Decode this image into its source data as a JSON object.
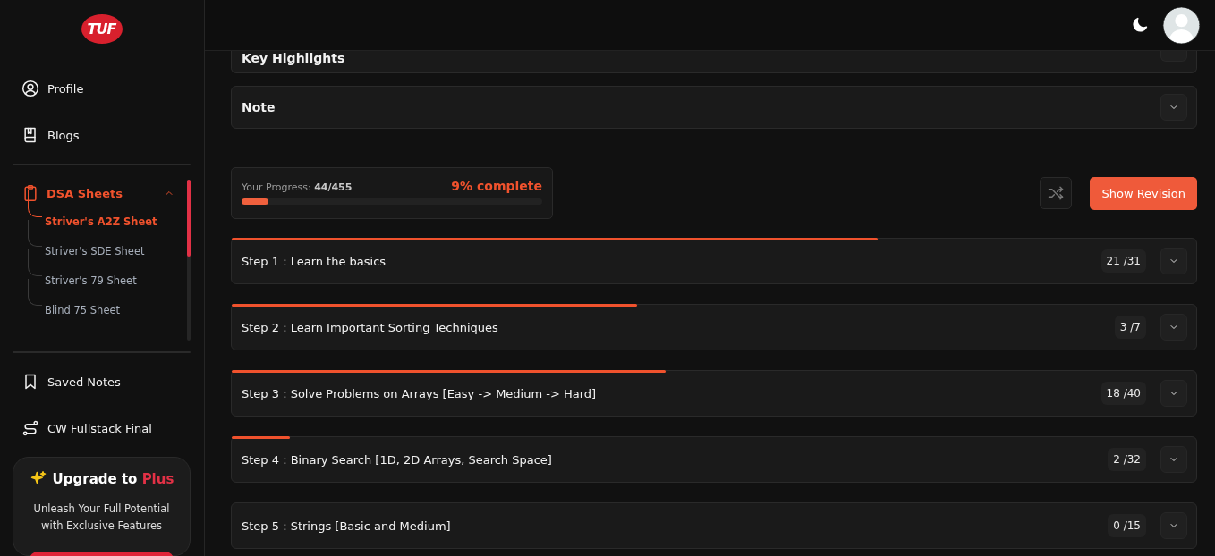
{
  "sidebar": {
    "logo": "TUF",
    "nav_top": [
      {
        "label": "Profile"
      },
      {
        "label": "Blogs"
      }
    ],
    "group": {
      "label": "DSA Sheets",
      "expanded": true,
      "children": [
        {
          "label": "Striver's A2Z Sheet",
          "selected": true
        },
        {
          "label": "Striver's SDE Sheet",
          "selected": false
        },
        {
          "label": "Striver's 79 Sheet",
          "selected": false
        },
        {
          "label": "Blind 75 Sheet",
          "selected": false
        }
      ]
    },
    "nav_bottom": [
      {
        "label": "Saved Notes"
      },
      {
        "label": "CW Fullstack Final"
      }
    ],
    "upgrade": {
      "title": "Upgrade to",
      "highlight": "Plus",
      "text": "Unleash Your Full Potential with Exclusive Features"
    }
  },
  "sections": [
    {
      "title": "Key Highlights"
    },
    {
      "title": "Note"
    }
  ],
  "progress": {
    "label": "Your Progress:",
    "value": "44/455",
    "percent": "9% complete",
    "level": 0.09
  },
  "revision_button": "Show Revision",
  "steps": [
    {
      "title": "Step 1 : Learn the basics",
      "count": "21 /31",
      "level": 0.67
    },
    {
      "title": "Step 2 : Learn Important Sorting Techniques",
      "count": "3 /7",
      "level": 0.42
    },
    {
      "title": "Step 3 : Solve Problems on Arrays [Easy -> Medium -> Hard]",
      "count": "18 /40",
      "level": 0.45
    },
    {
      "title": "Step 4 : Binary Search [1D, 2D Arrays, Search Space]",
      "count": "2 /32",
      "level": 0.06
    },
    {
      "title": "Step 5 : Strings [Basic and Medium]",
      "count": "0 /15"
    }
  ]
}
